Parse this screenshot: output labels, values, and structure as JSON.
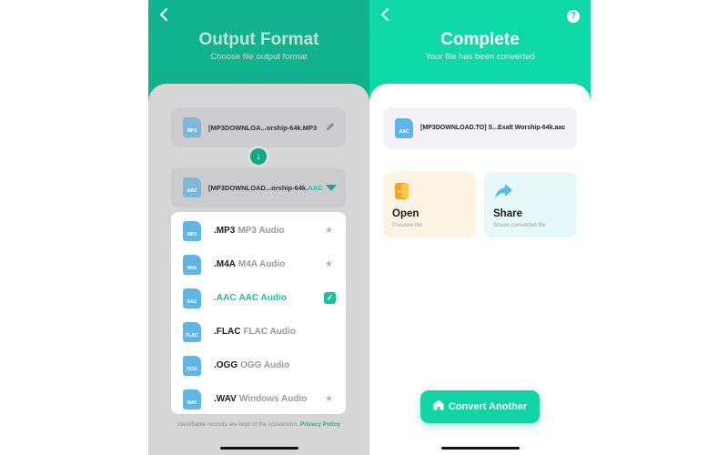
{
  "left_screen": {
    "header": {
      "back_icon": "chevron-left-icon",
      "title": "Output Format",
      "subtitle": "Choose file output format"
    },
    "source_file": {
      "icon_label": "MP3",
      "name": "[MP3DOWNLOA...orship-64k.MP3",
      "edit_icon": "pencil-icon"
    },
    "convert_arrow_icon": "arrow-down-icon",
    "target_file": {
      "icon_label": "AAC",
      "name_prefix": "[MP3DOWNLOAD...orship-64k.",
      "name_ext": "AAC",
      "dropdown_icon": "triangle-down-icon"
    },
    "format_menu": [
      {
        "icon_label": "MP3",
        "ext": ".MP3",
        "desc": "MP3 Audio",
        "marker": "star",
        "selected": false
      },
      {
        "icon_label": "M4A",
        "ext": ".M4A",
        "desc": "M4A Audio",
        "marker": "star",
        "selected": false
      },
      {
        "icon_label": "AAC",
        "ext": ".AAC",
        "desc": "AAC Audio",
        "marker": "check",
        "selected": true
      },
      {
        "icon_label": "FLAC",
        "ext": ".FLAC",
        "desc": "FLAC Audio",
        "marker": "",
        "selected": false
      },
      {
        "icon_label": "OGG",
        "ext": ".OGG",
        "desc": "OGG Audio",
        "marker": "",
        "selected": false
      },
      {
        "icon_label": "WAV",
        "ext": ".WAV",
        "desc": "Windows Audio",
        "marker": "star",
        "selected": false
      }
    ],
    "privacy_note": "identifiable records are kept of the conversion.",
    "privacy_link": "Privacy Policy"
  },
  "right_screen": {
    "header": {
      "back_icon": "chevron-left-icon",
      "help_icon": "?",
      "title": "Complete",
      "subtitle": "Your file has been converted"
    },
    "converted_file": {
      "icon_label": "AAC",
      "name": "[MP3DOWNLOAD.TO] S...Exalt Worship-64k.aac"
    },
    "actions": [
      {
        "label": "Open",
        "sub": "Preview file",
        "icon": "open-door-icon"
      },
      {
        "label": "Share",
        "sub": "Share converted file",
        "icon": "share-arrow-icon"
      }
    ],
    "convert_another_label": "Convert Another"
  },
  "colors": {
    "accent": "#18c39c",
    "left_header": "#12b390",
    "right_header": "#06dea8",
    "open_card": "#fdf3e3",
    "share_card": "#e6f8f8"
  }
}
